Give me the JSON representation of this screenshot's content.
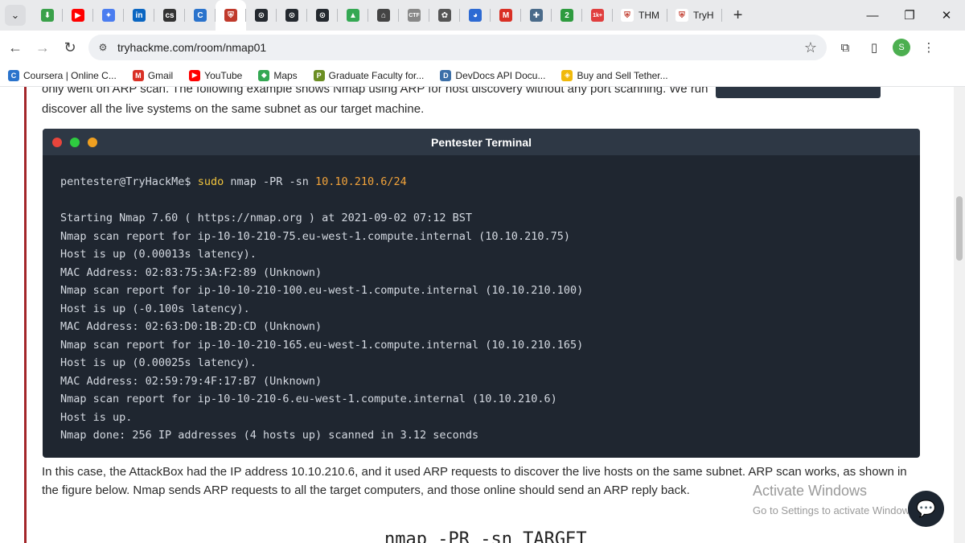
{
  "browser": {
    "tab_search_icon": "chevron-down-icon",
    "tabs": [
      {
        "icon": "download-icon",
        "color": "#3aa14a",
        "glyph": "⬇"
      },
      {
        "icon": "youtube-icon",
        "color": "#ff0000",
        "glyph": "▶"
      },
      {
        "icon": "gemini-icon",
        "color": "#4a7df0",
        "glyph": "✦"
      },
      {
        "icon": "linkedin-icon",
        "color": "#0a66c2",
        "glyph": "in"
      },
      {
        "icon": "cs-icon",
        "color": "#333333",
        "glyph": "cs"
      },
      {
        "icon": "coursera-icon",
        "color": "#2a73cc",
        "glyph": "C"
      },
      {
        "icon": "tryhackme-icon",
        "color": "#c0392b",
        "glyph": "⛨",
        "active": true
      },
      {
        "icon": "github-icon",
        "color": "#24292f",
        "glyph": "⊙"
      },
      {
        "icon": "github-icon",
        "color": "#24292f",
        "glyph": "⊙"
      },
      {
        "icon": "github-icon",
        "color": "#24292f",
        "glyph": "⊙"
      },
      {
        "icon": "drive-icon",
        "color": "#34a853",
        "glyph": "▲"
      },
      {
        "icon": "museum-icon",
        "color": "#444444",
        "glyph": "⌂"
      },
      {
        "icon": "ctf-icon",
        "color": "#888888",
        "glyph": "CTF"
      },
      {
        "icon": "cat-icon",
        "color": "#555555",
        "glyph": "✿"
      },
      {
        "icon": "globe-icon",
        "color": "#2d6ad3",
        "glyph": "◕"
      },
      {
        "icon": "gmail-icon",
        "color": "#d93025",
        "glyph": "M"
      },
      {
        "icon": "puzzle-icon",
        "color": "#4a6b8a",
        "glyph": "✚"
      },
      {
        "icon": "badge-2-icon",
        "color": "#2e9b3f",
        "glyph": "2"
      },
      {
        "icon": "notifications-icon",
        "color": "#e03e3e",
        "glyph": "1k+"
      }
    ],
    "wide_tabs": [
      {
        "icon": "tryhackme-icon",
        "label": "THM"
      },
      {
        "icon": "tryhackme-icon",
        "label": "TryH"
      }
    ],
    "new_tab_glyph": "+",
    "window_controls": [
      "—",
      "❐",
      "✕"
    ],
    "url": "tryhackme.com/room/nmap01",
    "profile_initial": "S"
  },
  "bookmarks": [
    {
      "label": "Coursera | Online C...",
      "icon": "coursera-icon",
      "color": "#2a73cc",
      "glyph": "C"
    },
    {
      "label": "Gmail",
      "icon": "gmail-icon",
      "color": "#d93025",
      "glyph": "M"
    },
    {
      "label": "YouTube",
      "icon": "youtube-icon",
      "color": "#ff0000",
      "glyph": "▶"
    },
    {
      "label": "Maps",
      "icon": "maps-icon",
      "color": "#34a853",
      "glyph": "◆"
    },
    {
      "label": "Graduate Faculty for...",
      "icon": "graduate-icon",
      "color": "#6b8e23",
      "glyph": "P"
    },
    {
      "label": "DevDocs API Docu...",
      "icon": "devdocs-icon",
      "color": "#3b6fa8",
      "glyph": "D"
    },
    {
      "label": "Buy and Sell Tether...",
      "icon": "binance-icon",
      "color": "#f0b90b",
      "glyph": "◈"
    }
  ],
  "content": {
    "cut_line": "only went on ARP scan. The following example shows Nmap using ARP for host discovery without any port scanning. We run",
    "para1": "discover all the live systems on the same subnet as our target machine.",
    "para2": "In this case, the AttackBox had the IP address 10.10.210.6, and it used ARP requests to discover the live hosts on the same subnet. ARP scan works, as shown in",
    "para3": "the figure below. Nmap sends ARP requests to all the target computers, and those online should send an ARP reply back.",
    "bottom_code": "nmap -PR -sn TARGET"
  },
  "terminal": {
    "title": "Pentester Terminal",
    "dot_colors": [
      "#e8453c",
      "#2ecc40",
      "#f0a020"
    ],
    "prompt": "pentester@TryHackMe$",
    "command": " sudo",
    "command_args": " nmap -PR -sn ",
    "target_ip": "10.10.210.6/24",
    "output": [
      "Starting Nmap 7.60 ( https://nmap.org ) at 2021-09-02 07:12 BST",
      "Nmap scan report for ip-10-10-210-75.eu-west-1.compute.internal (10.10.210.75)",
      "Host is up (0.00013s latency).",
      "MAC Address: 02:83:75:3A:F2:89 (Unknown)",
      "Nmap scan report for ip-10-10-210-100.eu-west-1.compute.internal (10.10.210.100)",
      "Host is up (-0.100s latency).",
      "MAC Address: 02:63:D0:1B:2D:CD (Unknown)",
      "Nmap scan report for ip-10-10-210-165.eu-west-1.compute.internal (10.10.210.165)",
      "Host is up (0.00025s latency).",
      "MAC Address: 02:59:79:4F:17:B7 (Unknown)",
      "Nmap scan report for ip-10-10-210-6.eu-west-1.compute.internal (10.10.210.6)",
      "Host is up.",
      "Nmap done: 256 IP addresses (4 hosts up) scanned in 3.12 seconds"
    ]
  },
  "overlay": {
    "activate_title": "Activate Windows",
    "activate_sub": "Go to Settings to activate Windows.",
    "chat_icon": "chat-bubble-icon"
  }
}
